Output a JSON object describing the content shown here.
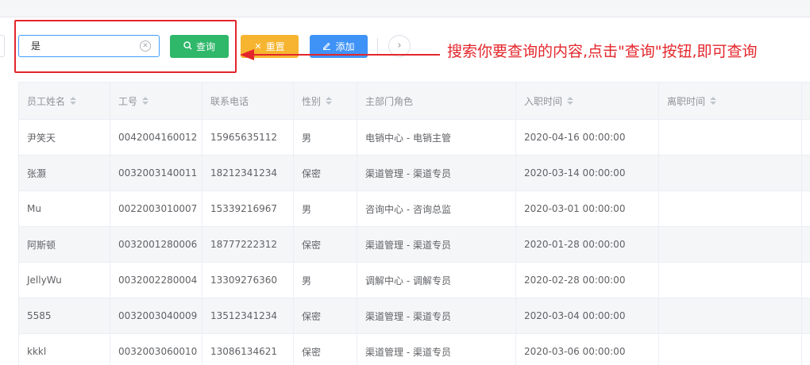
{
  "toolbar": {
    "search_value": "是",
    "query_label": "查询",
    "reset_label": "重置",
    "add_label": "添加"
  },
  "annotation": {
    "text": "搜索你要查询的内容,点击\"查询\"按钮,即可查询",
    "color": "#e3262b"
  },
  "icons": {
    "clear": "clear-circle-icon",
    "search": "search-icon",
    "close": "close-icon",
    "edit": "edit-icon",
    "more": "chevron-right-icon",
    "sort": "sort-caret-icon"
  },
  "table": {
    "headers": [
      "员工姓名",
      "工号",
      "联系电话",
      "性别",
      "主部门角色",
      "入职时间",
      "离职时间"
    ],
    "rows": [
      [
        "尹笑天",
        "0042004160012",
        "15965635112",
        "男",
        "电销中心 - 电销主管",
        "2020-04-16 00:00:00",
        ""
      ],
      [
        "张灏",
        "0032003140011",
        "18212341234",
        "保密",
        "渠道管理 - 渠道专员",
        "2020-03-14 00:00:00",
        ""
      ],
      [
        "Mu",
        "0022003010007",
        "15339216967",
        "男",
        "咨询中心 - 咨询总监",
        "2020-03-01 00:00:00",
        ""
      ],
      [
        "阿斯顿",
        "0032001280006",
        "18777222312",
        "保密",
        "渠道管理 - 渠道专员",
        "2020-01-28 00:00:00",
        ""
      ],
      [
        "JellyWu",
        "0032002280004",
        "13309276360",
        "男",
        "调解中心 - 调解专员",
        "2020-02-28 00:00:00",
        ""
      ],
      [
        "5585",
        "0032003040009",
        "13512341234",
        "保密",
        "渠道管理 - 渠道专员",
        "2020-03-04 00:00:00",
        ""
      ],
      [
        "kkkl",
        "0032003060010",
        "13086134621",
        "保密",
        "渠道管理 - 渠道专员",
        "2020-03-06 00:00:00",
        ""
      ]
    ]
  }
}
